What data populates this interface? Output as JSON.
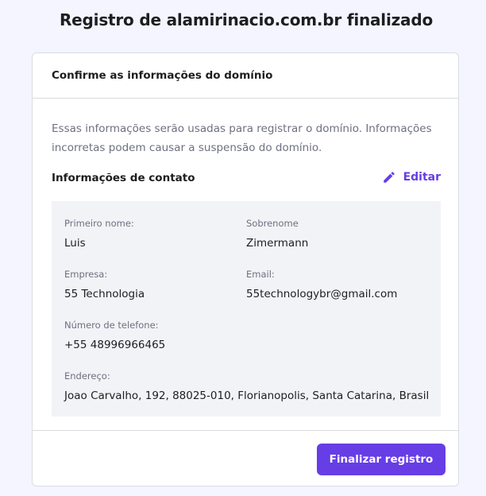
{
  "page": {
    "title": "Registro de alamirinacio.com.br finalizado"
  },
  "card": {
    "header": "Confirme as informações do domínio",
    "description": "Essas informações serão usadas para registrar o domínio. Informações incorretas podem causar a suspensão do domínio.",
    "contact_section": {
      "title": "Informações de contato",
      "edit_label": "Editar",
      "edit_icon": "pencil-icon"
    },
    "fields": {
      "first_name": {
        "label": "Primeiro nome:",
        "value": "Luis"
      },
      "last_name": {
        "label": "Sobrenome",
        "value": "Zimermann"
      },
      "company": {
        "label": "Empresa:",
        "value": "55 Technologia"
      },
      "email": {
        "label": "Email:",
        "value": "55technologybr@gmail.com"
      },
      "phone": {
        "label": "Número de telefone:",
        "value": "+55 48996966465"
      },
      "address": {
        "label": "Endereço:",
        "value": "Joao Carvalho, 192, 88025-010, Florianopolis, Santa Catarina, Brasil"
      }
    },
    "submit_label": "Finalizar registro"
  },
  "colors": {
    "accent": "#673de6",
    "page_background": "#f4f5ff",
    "info_background": "#f2f3f6"
  }
}
